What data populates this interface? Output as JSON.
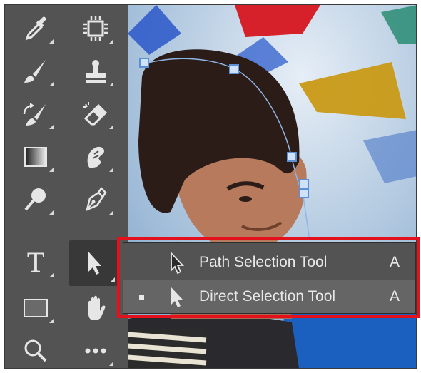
{
  "toolbar": {
    "tools": [
      {
        "name": "eyedropper-tool",
        "icon": "eyedropper-icon"
      },
      {
        "name": "artboard-tool",
        "icon": "artboard-icon"
      },
      {
        "name": "brush-tool",
        "icon": "brush-icon"
      },
      {
        "name": "clone-stamp-tool",
        "icon": "stamp-icon"
      },
      {
        "name": "history-brush-tool",
        "icon": "history-brush-icon"
      },
      {
        "name": "eraser-tool",
        "icon": "eraser-icon"
      },
      {
        "name": "gradient-tool",
        "icon": "gradient-icon"
      },
      {
        "name": "smudge-tool",
        "icon": "smudge-icon"
      },
      {
        "name": "dodge-tool",
        "icon": "dodge-icon"
      },
      {
        "name": "pen-tool",
        "icon": "pen-icon"
      },
      {
        "name": "type-tool",
        "icon": "type-icon",
        "letter": "T"
      },
      {
        "name": "selection-tool",
        "icon": "arrow-cursor-icon",
        "active": true
      },
      {
        "name": "rectangle-tool",
        "icon": "rectangle-icon"
      },
      {
        "name": "hand-tool",
        "icon": "hand-icon"
      },
      {
        "name": "zoom-tool",
        "icon": "magnifier-icon"
      },
      {
        "name": "more-tools",
        "icon": "ellipsis-icon"
      }
    ]
  },
  "flyout": {
    "items": [
      {
        "label": "Path Selection Tool",
        "shortcut": "A",
        "icon": "black-arrow-cursor-icon",
        "selected": false
      },
      {
        "label": "Direct Selection Tool",
        "shortcut": "A",
        "icon": "white-arrow-cursor-icon",
        "selected": true
      }
    ],
    "highlight_color": "#e4101b"
  },
  "colors": {
    "toolbar_bg": "#535353",
    "menu_bg": "#535353",
    "menu_selected_bg": "#656565",
    "text": "#e8e8e8"
  }
}
